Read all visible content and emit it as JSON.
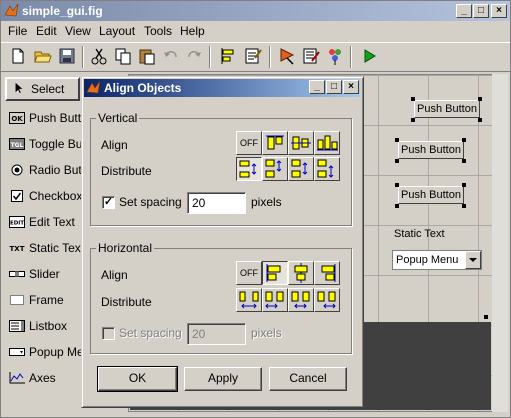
{
  "window": {
    "title": "simple_gui.fig",
    "minimize": "_",
    "maximize": "□",
    "close": "×"
  },
  "menu": [
    "File",
    "Edit",
    "View",
    "Layout",
    "Tools",
    "Help"
  ],
  "palette": {
    "items": [
      {
        "label": "Select",
        "icon": "arrow-pointer-icon"
      },
      {
        "label": "Push Button",
        "icon": "ok-badge-icon"
      },
      {
        "label": "Toggle Button",
        "icon": "tgl-badge-icon"
      },
      {
        "label": "Radio Button",
        "icon": "radio-icon"
      },
      {
        "label": "Checkbox",
        "icon": "checkbox-icon"
      },
      {
        "label": "Edit Text",
        "icon": "edit-text-icon"
      },
      {
        "label": "Static Text",
        "icon": "static-text-icon"
      },
      {
        "label": "Slider",
        "icon": "slider-icon"
      },
      {
        "label": "Frame",
        "icon": "frame-icon"
      },
      {
        "label": "Listbox",
        "icon": "listbox-icon"
      },
      {
        "label": "Popup Menu",
        "icon": "popup-icon"
      },
      {
        "label": "Axes",
        "icon": "axes-icon"
      }
    ],
    "icon_text": {
      "ok": "OK",
      "tgl": "TGL",
      "edit": "EDIT",
      "txt": "TXT"
    }
  },
  "canvas": {
    "push_buttons": [
      "Push Button",
      "Push Button",
      "Push Button"
    ],
    "static_text": "Static Text",
    "popup_menu": "Popup Menu"
  },
  "dialog": {
    "title": "Align Objects",
    "title_buttons": {
      "minimize": "_",
      "maximize": "□",
      "close": "×"
    },
    "vertical": {
      "group_label": "Vertical",
      "align_label": "Align",
      "distribute_label": "Distribute",
      "off_label": "OFF",
      "set_spacing_label": "Set spacing",
      "set_spacing_checked": true,
      "spacing_value": "20",
      "pixels_label": "pixels"
    },
    "horizontal": {
      "group_label": "Horizontal",
      "align_label": "Align",
      "distribute_label": "Distribute",
      "off_label": "OFF",
      "set_spacing_label": "Set spacing",
      "set_spacing_checked": false,
      "spacing_value": "20",
      "pixels_label": "pixels"
    },
    "buttons": {
      "ok": "OK",
      "apply": "Apply",
      "cancel": "Cancel"
    }
  },
  "colors": {
    "face": "#d4d0c8",
    "titlebar_inactive": "#7a8aa8",
    "titlebar_active": "#0a246a",
    "icon_yellow": "#ffff00",
    "icon_blue": "#0000c0"
  }
}
